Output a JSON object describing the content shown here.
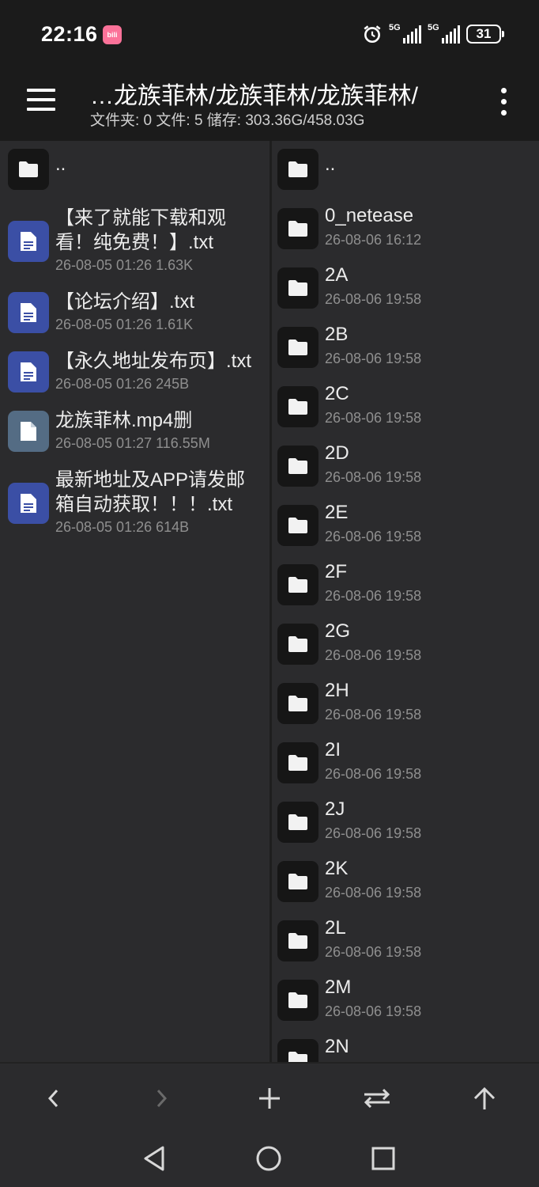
{
  "status_bar": {
    "time": "22:16",
    "app_badge": "bili",
    "network_1": "5G",
    "network_2": "5G",
    "battery": "31"
  },
  "toolbar": {
    "path": "…龙族菲林/龙族菲林/龙族菲林/",
    "stats": "文件夹: 0  文件: 5  储存: 303.36G/458.03G"
  },
  "left_pane": {
    "parent": "..",
    "items": [
      {
        "name": "【来了就能下载和观看！纯免费！】.txt",
        "meta": "26-08-05 01:26  1.63K",
        "type": "doc"
      },
      {
        "name": "【论坛介绍】.txt",
        "meta": "26-08-05 01:26  1.61K",
        "type": "doc"
      },
      {
        "name": "【永久地址发布页】.txt",
        "meta": "26-08-05 01:26  245B",
        "type": "doc"
      },
      {
        "name": "龙族菲林.mp4删",
        "meta": "26-08-05 01:27  116.55M",
        "type": "video"
      },
      {
        "name": "最新地址及APP请发邮箱自动获取！！！.txt",
        "meta": "26-08-05 01:26  614B",
        "type": "doc"
      }
    ]
  },
  "right_pane": {
    "parent": "..",
    "items": [
      {
        "name": "0_netease",
        "meta": "26-08-06 16:12"
      },
      {
        "name": "2A",
        "meta": "26-08-06 19:58"
      },
      {
        "name": "2B",
        "meta": "26-08-06 19:58"
      },
      {
        "name": "2C",
        "meta": "26-08-06 19:58"
      },
      {
        "name": "2D",
        "meta": "26-08-06 19:58"
      },
      {
        "name": "2E",
        "meta": "26-08-06 19:58"
      },
      {
        "name": "2F",
        "meta": "26-08-06 19:58"
      },
      {
        "name": "2G",
        "meta": "26-08-06 19:58"
      },
      {
        "name": "2H",
        "meta": "26-08-06 19:58"
      },
      {
        "name": "2I",
        "meta": "26-08-06 19:58"
      },
      {
        "name": "2J",
        "meta": "26-08-06 19:58"
      },
      {
        "name": "2K",
        "meta": "26-08-06 19:58"
      },
      {
        "name": "2L",
        "meta": "26-08-06 19:58"
      },
      {
        "name": "2M",
        "meta": "26-08-06 19:58"
      },
      {
        "name": "2N",
        "meta": ""
      }
    ]
  },
  "action_bar": [
    "back-icon",
    "forward-icon",
    "add-icon",
    "swap-icon",
    "up-icon"
  ],
  "nav_bar": [
    "nav-back-icon",
    "nav-home-icon",
    "nav-recents-icon"
  ]
}
